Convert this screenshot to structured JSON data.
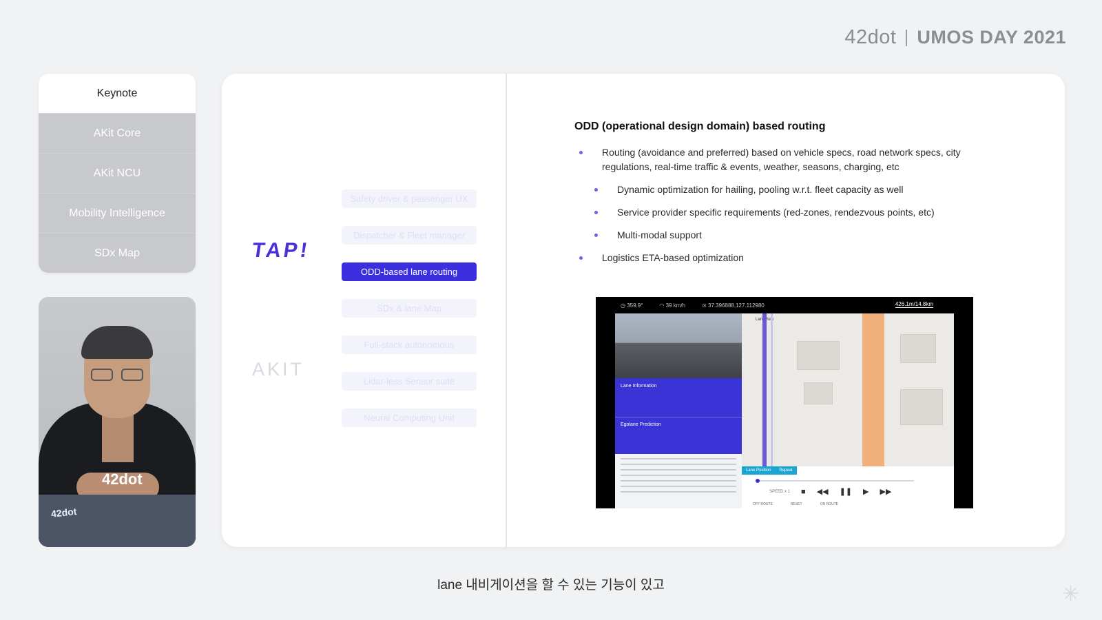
{
  "brand": {
    "logo": "42dot",
    "event": "UMOS DAY 2021"
  },
  "nav": {
    "items": [
      {
        "label": "Keynote"
      },
      {
        "label": "AKit Core"
      },
      {
        "label": "AKit NCU"
      },
      {
        "label": "Mobility Intelligence"
      },
      {
        "label": "SDx Map"
      }
    ]
  },
  "speaker": {
    "shirt_text": "42dot",
    "sticker": "42dot"
  },
  "slide": {
    "tap_logo": "TAP!",
    "akit_logo": "AKIT",
    "pills": [
      {
        "label": "Safety driver & passenger UX"
      },
      {
        "label": "Dispatcher & Fleet manager"
      },
      {
        "label": "ODD-based lane routing"
      },
      {
        "label": "SDx & lane Map"
      },
      {
        "label": "Full-stack autonomous"
      },
      {
        "label": "Lidar-less Sensor suite"
      },
      {
        "label": "Neural Computing Unit"
      }
    ],
    "heading": "ODD (operational design domain) based routing",
    "bullets": [
      {
        "text": "Routing (avoidance and preferred) based on vehicle specs, road network specs, city regulations, real-time traffic & events, weather, seasons, charging, etc"
      },
      {
        "text": "Dynamic optimization for hailing, pooling w.r.t. fleet capacity as well"
      },
      {
        "text": "Service provider specific requirements (red-zones, rendezvous points, etc)"
      },
      {
        "text": "Multi-modal support"
      },
      {
        "text": "Logistics ETA-based optimization"
      }
    ],
    "screen": {
      "heading": "359.9°",
      "speed": "39 km/h",
      "coords": "37.396888,127.112980",
      "distance": "426.1m/14.8km",
      "lane_info": "Lane Information",
      "egolane": "Egolane Prediction",
      "map_label": "LaneView",
      "tag_lane": "Lane Position",
      "tag_repeat": "Repeat",
      "speed_control": "SPEED x 1",
      "off_route": "OFF ROUTE",
      "reset": "RESET",
      "on_route": "ON ROUTE"
    }
  },
  "subtitle": "lane 내비게이션을 할 수 있는 기능이 있고",
  "colors": {
    "accent": "#3b2fe0",
    "tap": "#4930d9"
  }
}
